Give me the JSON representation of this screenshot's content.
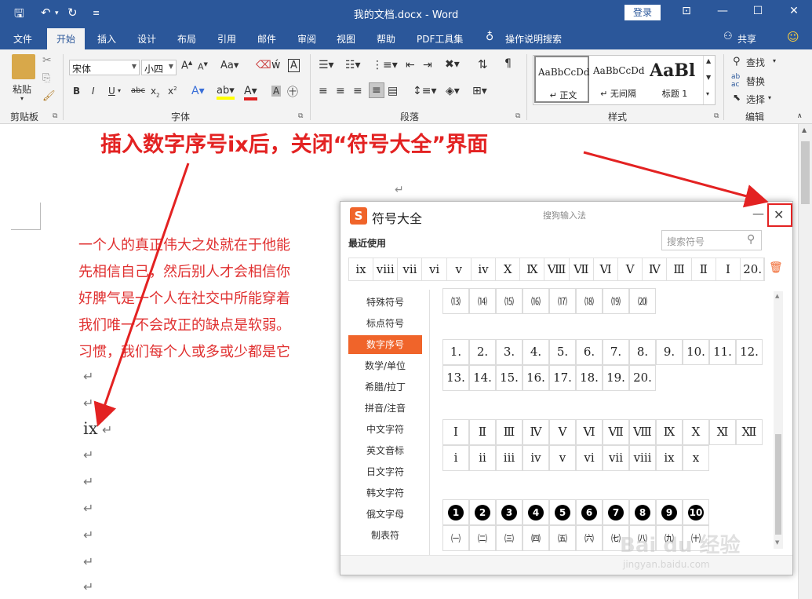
{
  "titlebar": {
    "title": "我的文档.docx  -  Word",
    "login": "登录",
    "bg": "#2b579a"
  },
  "menu": {
    "tabs": [
      "文件",
      "开始",
      "插入",
      "设计",
      "布局",
      "引用",
      "邮件",
      "审阅",
      "视图",
      "帮助",
      "PDF工具集"
    ],
    "tellme": "操作说明搜索",
    "share": "共享"
  },
  "ribbon": {
    "clipboard": {
      "label": "剪贴板",
      "paste": "粘贴"
    },
    "font": {
      "label": "字体",
      "name": "宋体",
      "size": "小四"
    },
    "paragraph": {
      "label": "段落"
    },
    "styles": {
      "label": "样式",
      "tiles": [
        {
          "preview": "AaBbCcDd",
          "name": "正文"
        },
        {
          "preview": "AaBbCcDd",
          "name": "无间隔"
        },
        {
          "preview": "AaBl",
          "name": "标题 1"
        }
      ]
    },
    "editing": {
      "label": "编辑",
      "find": "查找",
      "replace": "替换",
      "select": "选择"
    }
  },
  "document": {
    "lines": [
      "一个人的真正伟大之处就在于他能",
      "先相信自己，然后别人才会相信你",
      "好脾气是一个人在社交中所能穿着",
      "我们唯一不会改正的缺点是软弱。",
      "习惯，我们每个人或多或少都是它"
    ],
    "inserted": "ix",
    "text_color": "#e03030"
  },
  "annotation": {
    "text": "插入数字序号ix后，关闭“符号大全”界面",
    "color": "#e32222"
  },
  "dialog": {
    "title": "符号大全",
    "subtitle": "搜狗输入法",
    "recent_label": "最近使用",
    "search_placeholder": "搜索符号",
    "recent": [
      "ix",
      "viii",
      "vii",
      "vi",
      "v",
      "iv",
      "Ⅹ",
      "Ⅸ",
      "Ⅷ",
      "Ⅶ",
      "Ⅵ",
      "Ⅴ",
      "Ⅳ",
      "Ⅲ",
      "Ⅱ",
      "Ⅰ",
      "20."
    ],
    "categories": [
      "特殊符号",
      "标点符号",
      "数字序号",
      "数学/单位",
      "希腊/拉丁",
      "拼音/注音",
      "中文字符",
      "英文音标",
      "日文字符",
      "韩文字符",
      "俄文字母",
      "制表符"
    ],
    "active_category": 2,
    "accent": "#f0642a",
    "paren_numbers": [
      "⒀",
      "⒁",
      "⒂",
      "⒃",
      "⒄",
      "⒅",
      "⒆",
      "⒇"
    ],
    "dot_numbers_row1": [
      "1.",
      "2.",
      "3.",
      "4.",
      "5.",
      "6.",
      "7.",
      "8.",
      "9.",
      "10.",
      "11.",
      "12."
    ],
    "dot_numbers_row2": [
      "13.",
      "14.",
      "15.",
      "16.",
      "17.",
      "18.",
      "19.",
      "20."
    ],
    "roman_upper": [
      "Ⅰ",
      "Ⅱ",
      "Ⅲ",
      "Ⅳ",
      "Ⅴ",
      "Ⅵ",
      "Ⅶ",
      "Ⅷ",
      "Ⅸ",
      "Ⅹ",
      "Ⅺ",
      "Ⅻ"
    ],
    "roman_lower": [
      "i",
      "ii",
      "iii",
      "iv",
      "v",
      "vi",
      "vii",
      "viii",
      "ix",
      "x"
    ],
    "circled": [
      "1",
      "2",
      "3",
      "4",
      "5",
      "6",
      "7",
      "8",
      "9",
      "10"
    ],
    "paren_cn": [
      "㈠",
      "㈡",
      "㈢",
      "㈣",
      "㈤",
      "㈥",
      "㈦",
      "㈧",
      "㈨",
      "㈩"
    ]
  },
  "watermark": {
    "brand": "Bai du 经验",
    "url": "jingyan.baidu.com"
  }
}
